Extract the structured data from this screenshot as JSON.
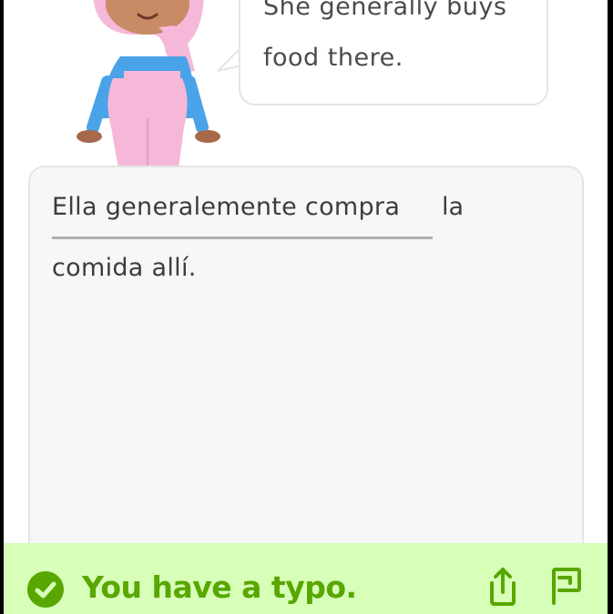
{
  "speech_bubble": {
    "line1": "She generally buys",
    "line2": "food there."
  },
  "answer": {
    "typed_text": "Ella generalemente compra",
    "after_text": "la",
    "line2": "comida allí."
  },
  "feedback": {
    "title": "You have a typo.",
    "accent_color": "#58a700",
    "background_color": "#d7ffb8"
  },
  "icons": {
    "check": "check-circle-icon",
    "share": "share-icon",
    "report": "flag-icon"
  }
}
